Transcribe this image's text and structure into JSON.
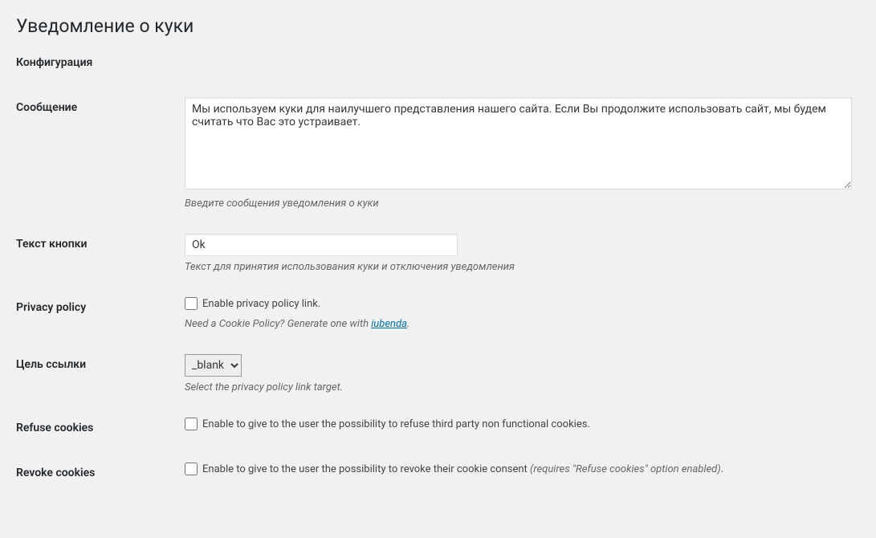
{
  "page": {
    "title": "Уведомление о куки",
    "section_title": "Конфигурация"
  },
  "message": {
    "label": "Сообщение",
    "value": "Мы используем куки для наилучшего представления нашего сайта. Если Вы продолжите использовать сайт, мы будем считать что Вас это устраивает.",
    "description": "Введите сообщения уведомления о куки"
  },
  "button_text": {
    "label": "Текст кнопки",
    "value": "Ok",
    "description": "Текст для принятия использования куки и отключения уведомления"
  },
  "privacy_policy": {
    "label": "Privacy policy",
    "checkbox_text": "Enable privacy policy link.",
    "description_pre": "Need a Cookie Policy? Generate one with ",
    "link_text": "iubenda",
    "description_post": "."
  },
  "link_target": {
    "label": "Цель ссылки",
    "selected": "_blank",
    "description": "Select the privacy policy link target."
  },
  "refuse": {
    "label": "Refuse cookies",
    "checkbox_text": "Enable to give to the user the possibility to refuse third party non functional cookies."
  },
  "revoke": {
    "label": "Revoke cookies",
    "checkbox_text_pre": "Enable to give to the user the possibility to revoke their cookie consent ",
    "checkbox_text_em": "(requires \"Refuse cookies\" option enabled)",
    "checkbox_text_post": "."
  }
}
